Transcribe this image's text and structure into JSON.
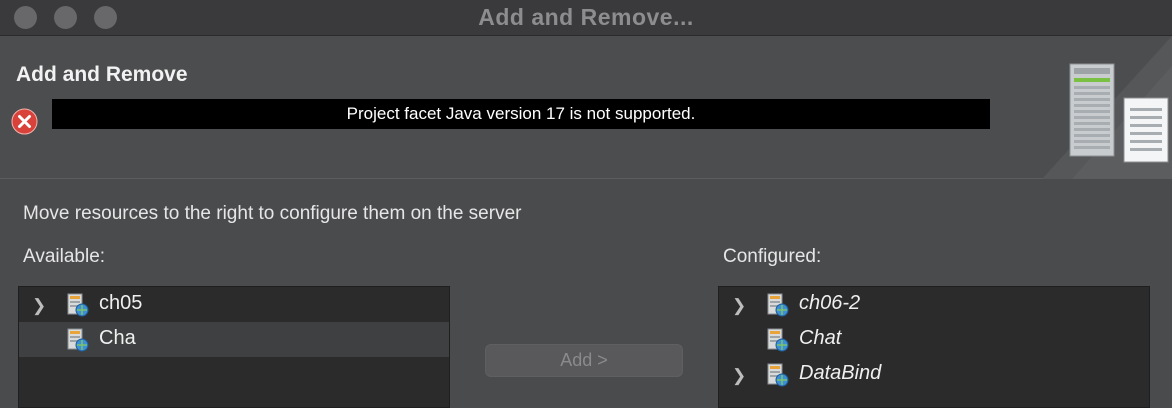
{
  "window": {
    "title": "Add and Remove..."
  },
  "header": {
    "title": "Add and Remove",
    "error_message": "Project facet Java version 17 is not supported."
  },
  "instructions": "Move resources to the right to configure them on the server",
  "available": {
    "label": "Available:",
    "items": [
      {
        "label": "ch05",
        "expandable": true,
        "selected": false
      },
      {
        "label": "Cha",
        "expandable": false,
        "selected": true
      }
    ]
  },
  "configured": {
    "label": "Configured:",
    "items": [
      {
        "label": "ch06-2",
        "expandable": true
      },
      {
        "label": "Chat",
        "expandable": false
      },
      {
        "label": "DataBind",
        "expandable": true
      }
    ]
  },
  "buttons": {
    "add": "Add >"
  },
  "icons": {
    "window_controls": [
      "close-button",
      "minimize-button",
      "zoom-button"
    ],
    "error": "error-icon",
    "project": "web-project-icon",
    "expand": "chevron-right-icon",
    "banner": "server-icon"
  },
  "colors": {
    "error": "#d9413b",
    "selection": "#3f4041",
    "list_bg": "#2b2b2c"
  }
}
